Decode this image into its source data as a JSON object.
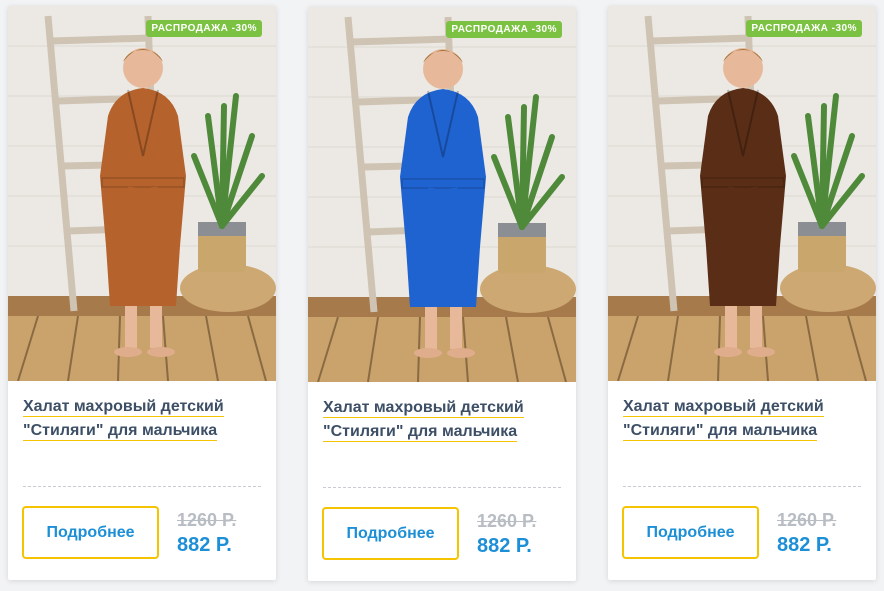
{
  "products": [
    {
      "badge": "РАСПРОДАЖА -30%",
      "title_line1": "Халат махровый детский",
      "title_line2": "\"Стиляги\" для мальчика",
      "button_label": "Подробнее",
      "old_price": "1260 Р.",
      "new_price": "882 Р.",
      "robe_color": "#b5622c",
      "image_icon": "product-photo-robe-orange"
    },
    {
      "badge": "РАСПРОДАЖА -30%",
      "title_line1": "Халат махровый детский",
      "title_line2": "\"Стиляги\" для мальчика",
      "button_label": "Подробнее",
      "old_price": "1260 Р.",
      "new_price": "882 Р.",
      "robe_color": "#1f63d1",
      "image_icon": "product-photo-robe-blue"
    },
    {
      "badge": "РАСПРОДАЖА -30%",
      "title_line1": "Халат махровый детский",
      "title_line2": "\"Стиляги\" для мальчика",
      "button_label": "Подробнее",
      "old_price": "1260 Р.",
      "new_price": "882 Р.",
      "robe_color": "#5a2d16",
      "image_icon": "product-photo-robe-brown"
    }
  ],
  "colors": {
    "badge_green": "#7cc242",
    "accent_blue": "#1c8fd6",
    "button_border_yellow": "#f5c400",
    "title_color": "#3d4f66",
    "old_price_gray": "#b8bdc4"
  }
}
